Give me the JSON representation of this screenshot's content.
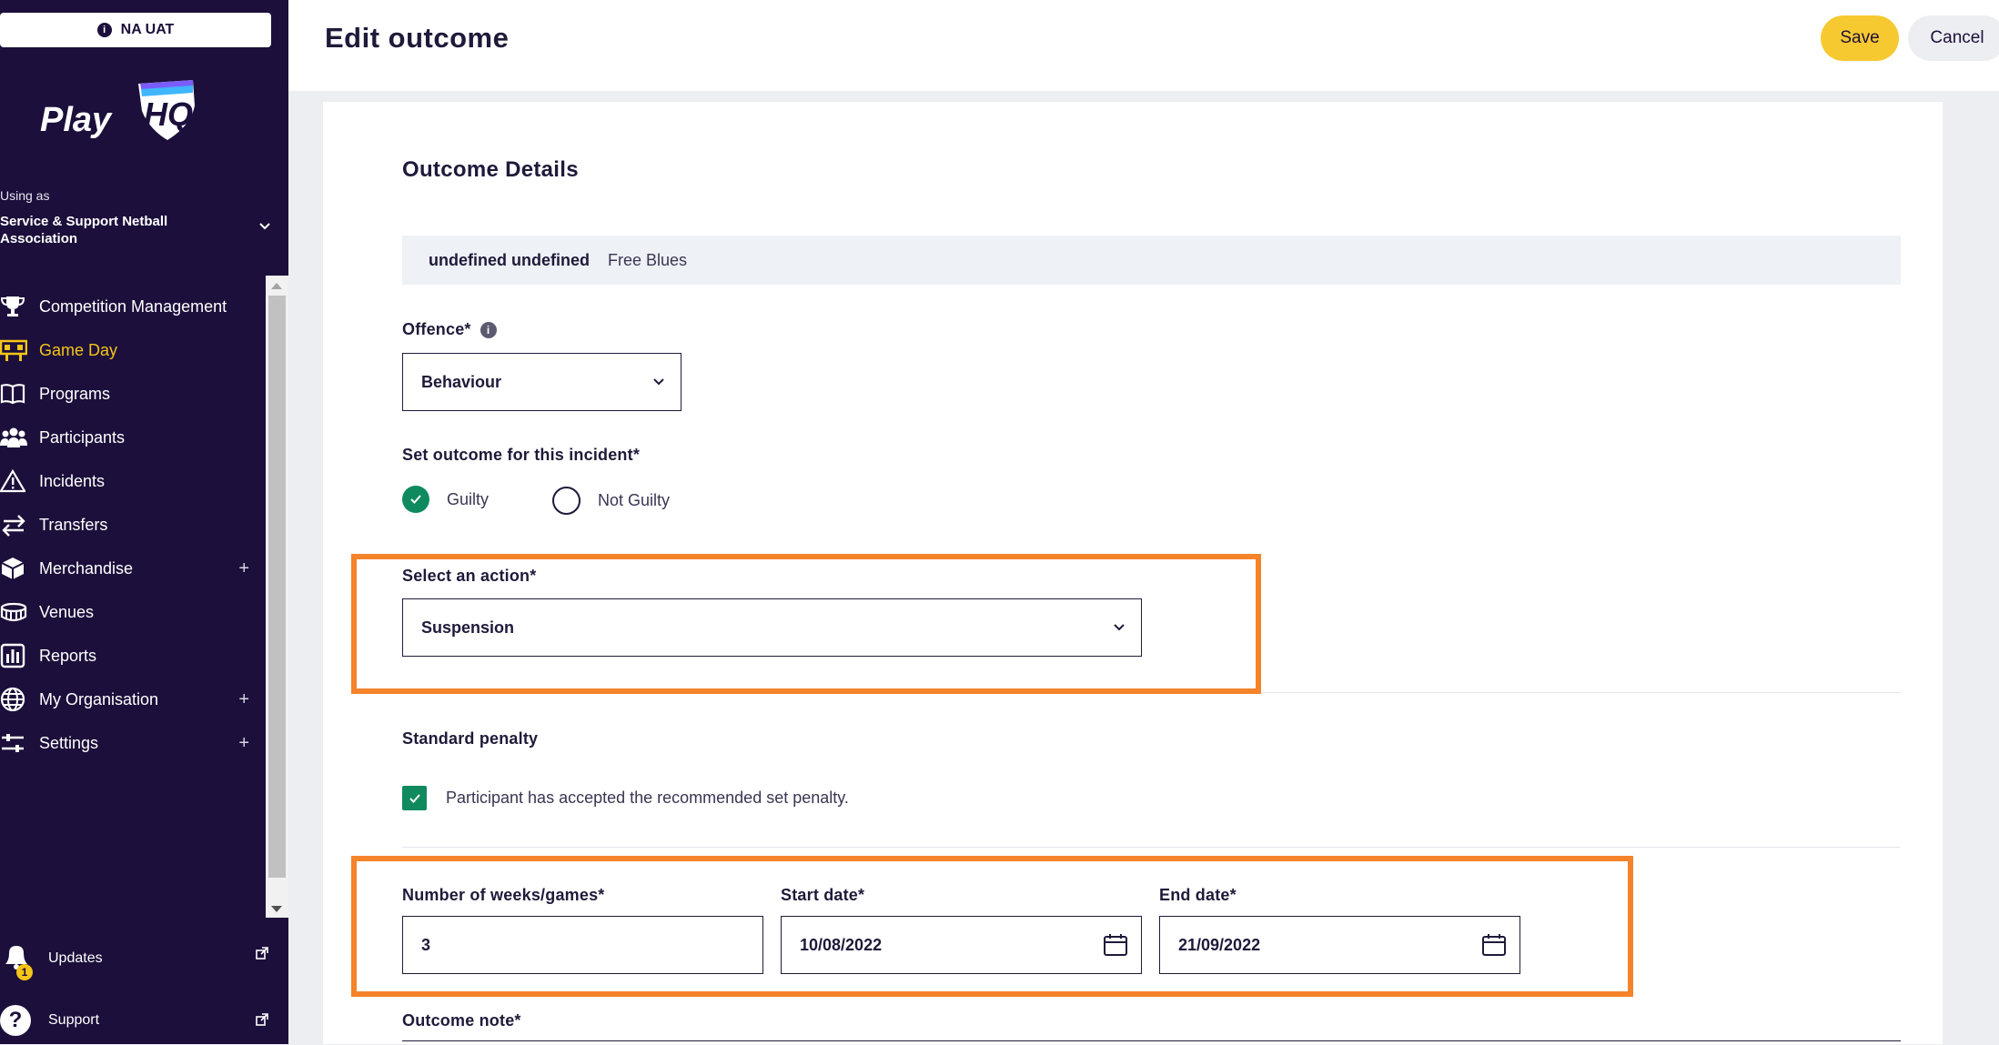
{
  "environment": {
    "badge_icon": "info-icon",
    "label": "NA UAT"
  },
  "brand": {
    "logo_text": "PlayHQ"
  },
  "account": {
    "using_as_label": "Using as",
    "org_name": "Service & Support Netball Association"
  },
  "nav": {
    "items": [
      {
        "label": "Competition Management",
        "icon": "trophy-icon",
        "active": false,
        "expandable": false
      },
      {
        "label": "Game Day",
        "icon": "scoreboard-icon",
        "active": true,
        "expandable": false
      },
      {
        "label": "Programs",
        "icon": "book-icon",
        "active": false,
        "expandable": false
      },
      {
        "label": "Participants",
        "icon": "people-icon",
        "active": false,
        "expandable": false
      },
      {
        "label": "Incidents",
        "icon": "warning-icon",
        "active": false,
        "expandable": false
      },
      {
        "label": "Transfers",
        "icon": "transfer-arrows-icon",
        "active": false,
        "expandable": false
      },
      {
        "label": "Merchandise",
        "icon": "box-icon",
        "active": false,
        "expandable": true
      },
      {
        "label": "Venues",
        "icon": "stadium-icon",
        "active": false,
        "expandable": false
      },
      {
        "label": "Reports",
        "icon": "bar-chart-icon",
        "active": false,
        "expandable": false
      },
      {
        "label": "My Organisation",
        "icon": "globe-icon",
        "active": false,
        "expandable": true
      },
      {
        "label": "Settings",
        "icon": "sliders-icon",
        "active": false,
        "expandable": true
      }
    ],
    "expand_symbol": "+"
  },
  "bottom": {
    "updates": {
      "label": "Updates",
      "icon": "bell-icon",
      "badge": "1"
    },
    "support": {
      "label": "Support",
      "icon": "question-icon"
    }
  },
  "header": {
    "title": "Edit outcome",
    "save_label": "Save",
    "cancel_label": "Cancel"
  },
  "form": {
    "section_title": "Outcome Details",
    "participant_name": "undefined undefined",
    "participant_team": "Free Blues",
    "offence": {
      "label": "Offence*",
      "value": "Behaviour"
    },
    "outcome": {
      "label": "Set outcome for this incident*",
      "options": [
        {
          "label": "Guilty",
          "selected": true
        },
        {
          "label": "Not Guilty",
          "selected": false
        }
      ]
    },
    "action": {
      "label": "Select an action*",
      "value": "Suspension"
    },
    "standard_penalty": {
      "label": "Standard penalty",
      "checkbox_label": "Participant has accepted the recommended set penalty.",
      "checked": true
    },
    "weeks": {
      "label": "Number of weeks/games*",
      "value": "3"
    },
    "start_date": {
      "label": "Start date*",
      "value": "10/08/2022"
    },
    "end_date": {
      "label": "End date*",
      "value": "21/09/2022"
    },
    "outcome_note": {
      "label": "Outcome note*"
    }
  },
  "colors": {
    "sidebar_bg": "#1c0f3b",
    "active_nav": "#f5c518",
    "save_button": "#f7c931",
    "success_green": "#0f8a5f",
    "highlight_orange": "#f4832a"
  }
}
